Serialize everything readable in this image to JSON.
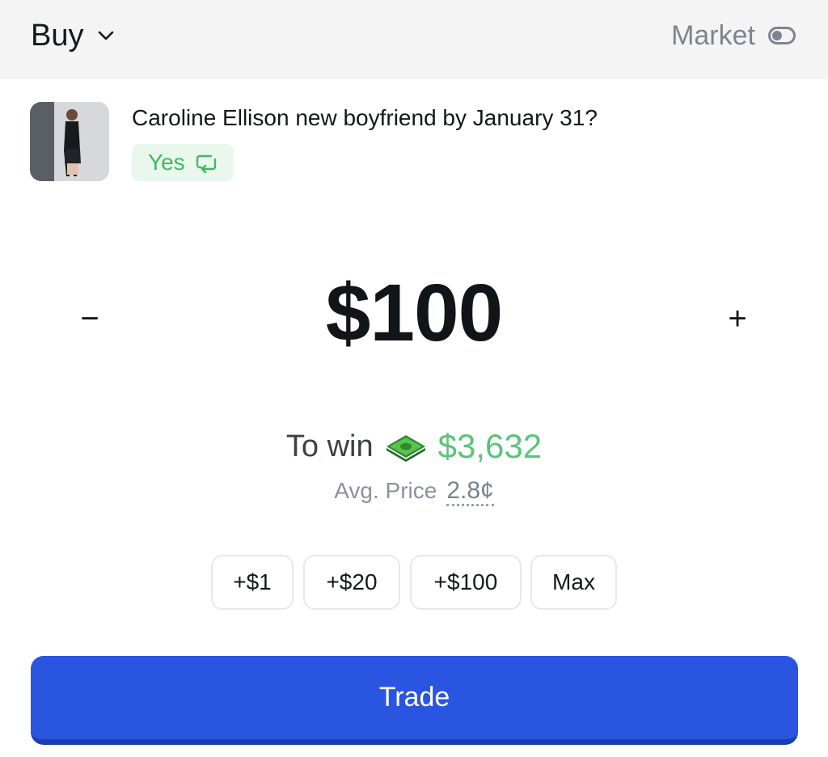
{
  "header": {
    "side_label": "Buy",
    "order_type_label": "Market"
  },
  "market": {
    "question": "Caroline Ellison new boyfriend by January 31?",
    "outcome": "Yes"
  },
  "order": {
    "minus_symbol": "−",
    "plus_symbol": "+",
    "amount": "$100"
  },
  "summary": {
    "to_win_label": "To win",
    "to_win_value": "$3,632",
    "avg_price_label": "Avg. Price",
    "avg_price_value": "2.8¢"
  },
  "quick_amounts": [
    "+$1",
    "+$20",
    "+$100",
    "Max"
  ],
  "trade_label": "Trade",
  "icons": {
    "side_dropdown": "chevron-down-icon",
    "order_toggle": "toggle-icon",
    "outcome_swap": "swap-icon",
    "to_win": "money-icon"
  },
  "colors": {
    "accent": "#2a55e0",
    "positive": "#5bc37a",
    "outcome_chip_bg": "#e9f7ec"
  }
}
